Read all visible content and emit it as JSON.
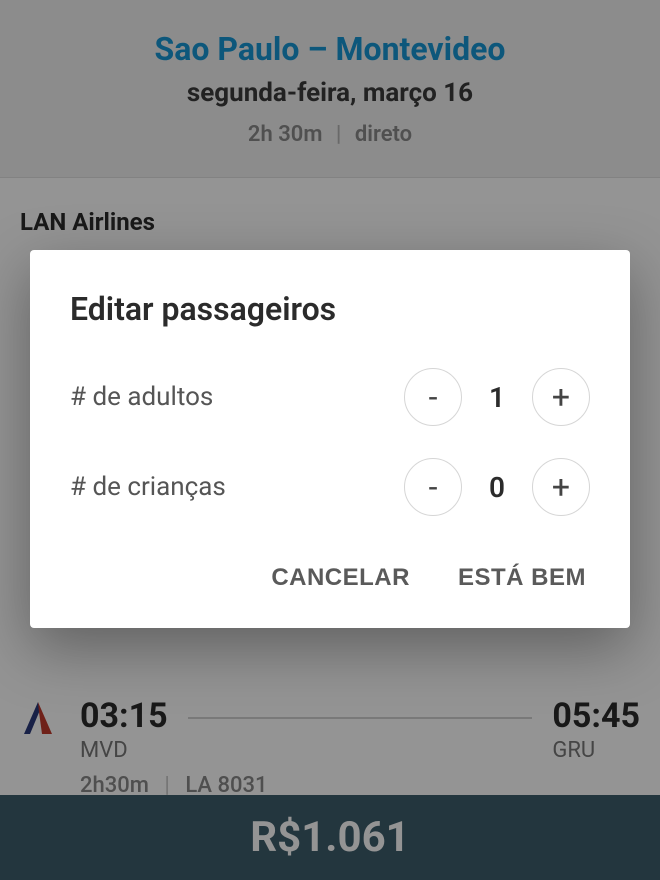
{
  "header": {
    "route": "Sao Paulo – Montevideo",
    "date": "segunda-feira, março 16",
    "duration": "2h 30m",
    "kind": "direto"
  },
  "content": {
    "airline": "LAN Airlines"
  },
  "dialog": {
    "title": "Editar passageiros",
    "adults_label": "# de adultos",
    "adults_value": "1",
    "children_label": "# de crianças",
    "children_value": "0",
    "minus": "-",
    "plus": "+",
    "cancel": "CANCELAR",
    "ok": "ESTÁ BEM"
  },
  "flight": {
    "dep_time": "03:15",
    "dep_code": "MVD",
    "arr_time": "05:45",
    "arr_code": "GRU",
    "duration": "2h30m",
    "number": "LA 8031"
  },
  "price": {
    "value": "R$1.061"
  }
}
